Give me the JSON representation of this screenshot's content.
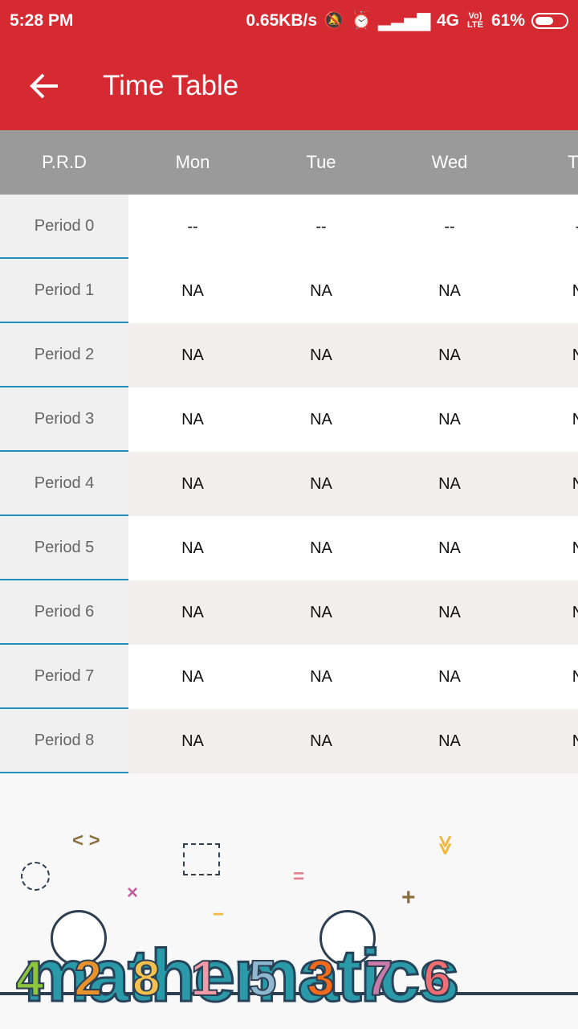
{
  "status_bar": {
    "time": "5:28 PM",
    "network_speed": "0.65KB/s",
    "network": "4G",
    "volte": "Vo) LTE",
    "battery": "61%",
    "battery_level": 0.61
  },
  "app_bar": {
    "title": "Time Table"
  },
  "table": {
    "headers": [
      "P.R.D",
      "Mon",
      "Tue",
      "Wed",
      "Th"
    ],
    "rows": [
      {
        "period": "Period 0",
        "values": [
          "--",
          "--",
          "--",
          "-"
        ]
      },
      {
        "period": "Period 1",
        "values": [
          "NA",
          "NA",
          "NA",
          "N"
        ]
      },
      {
        "period": "Period 2",
        "values": [
          "NA",
          "NA",
          "NA",
          "N"
        ]
      },
      {
        "period": "Period 3",
        "values": [
          "NA",
          "NA",
          "NA",
          "N"
        ]
      },
      {
        "period": "Period 4",
        "values": [
          "NA",
          "NA",
          "NA",
          "N"
        ]
      },
      {
        "period": "Period 5",
        "values": [
          "NA",
          "NA",
          "NA",
          "N"
        ]
      },
      {
        "period": "Period 6",
        "values": [
          "NA",
          "NA",
          "NA",
          "N"
        ]
      },
      {
        "period": "Period 7",
        "values": [
          "NA",
          "NA",
          "NA",
          "N"
        ]
      },
      {
        "period": "Period 8",
        "values": [
          "NA",
          "NA",
          "NA",
          "N"
        ]
      }
    ]
  },
  "banner": {
    "word": "mathematics",
    "numbers": [
      "4",
      "2",
      "8",
      "1",
      "5",
      "3",
      "7",
      "6"
    ],
    "number_colors": [
      "#8cc63f",
      "#e8922e",
      "#f4c04e",
      "#f29aa8",
      "#8fb7cf",
      "#f26a1b",
      "#c77aa7",
      "#ee6e73"
    ],
    "symbols": [
      "< >",
      "×",
      "=",
      "−",
      "+",
      "≫"
    ]
  }
}
